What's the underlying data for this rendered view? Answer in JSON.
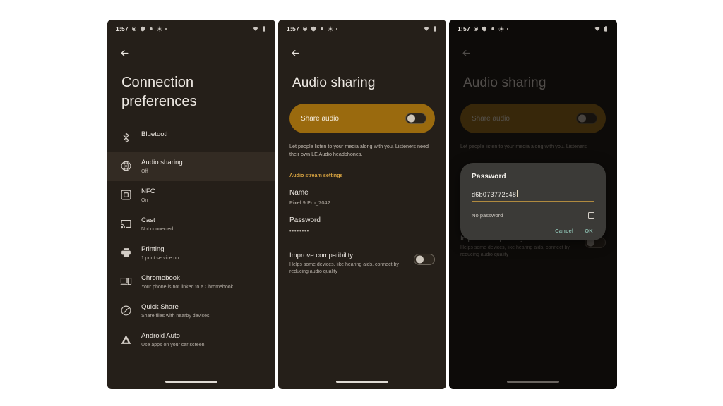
{
  "colors": {
    "page_bg": "#ffffff",
    "screen_bg": "#251f19",
    "screen_bg_dim": "#0d0b09",
    "accent_amber": "#d9a441",
    "share_card": "#9a6a0e",
    "dialog_bg": "#3b3a37",
    "dialog_accent": "#b08a3f",
    "dialog_button": "#87b5a8",
    "selected_row": "#332b23"
  },
  "statusbar": {
    "time": "1:57",
    "left_icons": [
      "location-icon",
      "vpn-key-icon",
      "notifications-silenced-icon",
      "brightness-icon",
      "dot-icon"
    ],
    "right_icons": [
      "wifi-icon",
      "battery-icon"
    ]
  },
  "phone1": {
    "back_label": "Back",
    "title": "Connection preferences",
    "items": [
      {
        "icon": "bluetooth-icon",
        "label": "Bluetooth",
        "sub": "",
        "selected": false
      },
      {
        "icon": "audio-sharing-icon",
        "label": "Audio sharing",
        "sub": "Off",
        "selected": true
      },
      {
        "icon": "nfc-icon",
        "label": "NFC",
        "sub": "On",
        "selected": false
      },
      {
        "icon": "cast-icon",
        "label": "Cast",
        "sub": "Not connected",
        "selected": false
      },
      {
        "icon": "printer-icon",
        "label": "Printing",
        "sub": "1 print service on",
        "selected": false
      },
      {
        "icon": "chromebook-icon",
        "label": "Chromebook",
        "sub": "Your phone is not linked to a Chromebook",
        "selected": false
      },
      {
        "icon": "quick-share-icon",
        "label": "Quick Share",
        "sub": "Share files with nearby devices",
        "selected": false
      },
      {
        "icon": "android-auto-icon",
        "label": "Android Auto",
        "sub": "Use apps on your car screen",
        "selected": false
      }
    ]
  },
  "phone2": {
    "title": "Audio sharing",
    "share_card": {
      "label": "Share audio",
      "toggle_state": "off"
    },
    "description": "Let people listen to your media along with you. Listeners need their own LE Audio headphones.",
    "section_header": "Audio stream settings",
    "name_field": {
      "label": "Name",
      "value": "Pixel 9 Pro_7042"
    },
    "password_field": {
      "label": "Password",
      "value": "••••••••"
    },
    "compatibility": {
      "title": "Improve compatibility",
      "sub": "Helps some devices, like hearing aids, connect by reducing audio quality",
      "toggle_state": "off"
    }
  },
  "phone3": {
    "title": "Audio sharing",
    "share_card": {
      "label": "Share audio",
      "toggle_state": "off"
    },
    "description": "Let people listen to your media along with you. Listeners",
    "compatibility": {
      "title": "Improve compatibility",
      "sub": "Helps some devices, like hearing aids, connect by reducing audio quality",
      "toggle_state": "off"
    },
    "dialog": {
      "title": "Password",
      "input_value": "d6b073772c48",
      "checkbox_label": "No password",
      "checkbox_checked": false,
      "cancel_label": "Cancel",
      "ok_label": "OK"
    }
  }
}
